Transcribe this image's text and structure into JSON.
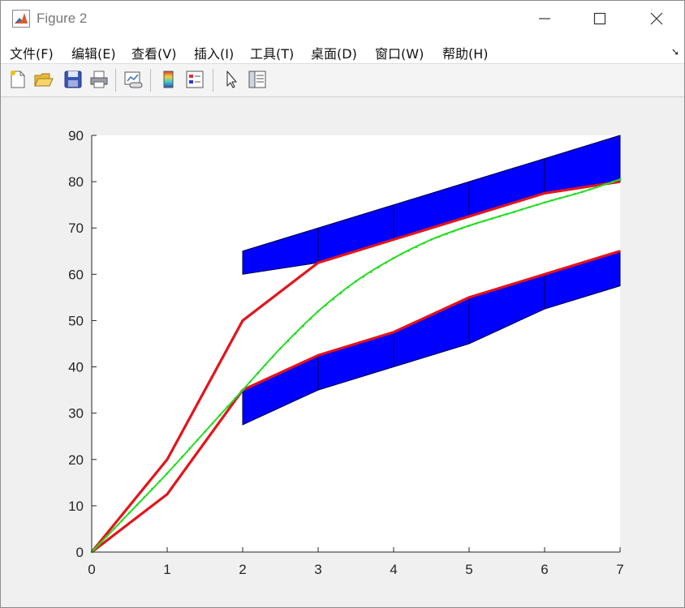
{
  "window": {
    "title": "Figure 2",
    "icon": "matlab-icon",
    "controls": [
      "minimize-icon",
      "maximize-icon",
      "close-icon"
    ]
  },
  "menu": {
    "items": [
      {
        "id": "file",
        "label": "文件(F)"
      },
      {
        "id": "edit",
        "label": "编辑(E)"
      },
      {
        "id": "view",
        "label": "查看(V)"
      },
      {
        "id": "insert",
        "label": "插入(I)"
      },
      {
        "id": "tools",
        "label": "工具(T)"
      },
      {
        "id": "desktop",
        "label": "桌面(D)"
      },
      {
        "id": "window",
        "label": "窗口(W)"
      },
      {
        "id": "help",
        "label": "帮助(H)"
      }
    ],
    "dock_icon": "dock-arrow-icon"
  },
  "toolbar": {
    "buttons": [
      "new-figure-icon",
      "open-file-icon",
      "save-icon",
      "print-icon",
      "link-plot-icon",
      "colorbar-icon",
      "legend-icon",
      "edit-plot-icon",
      "property-inspector-icon"
    ]
  },
  "colors": {
    "band": "#0000ff",
    "red_line": "#e3141b",
    "green_curve": "#22dd22",
    "axis": "#262626"
  },
  "chart_data": {
    "type": "line",
    "xlim": [
      0,
      7
    ],
    "ylim": [
      0,
      90
    ],
    "xticks": [
      "0",
      "1",
      "2",
      "3",
      "4",
      "5",
      "6",
      "7"
    ],
    "yticks": [
      "0",
      "10",
      "20",
      "30",
      "40",
      "50",
      "60",
      "70",
      "80",
      "90"
    ],
    "grid": false,
    "series": [
      {
        "kind": "line",
        "color": "#e3141b",
        "x": [
          0,
          1,
          2,
          3,
          4,
          5,
          6,
          7
        ],
        "y": [
          0,
          20,
          50,
          62.5,
          67.5,
          72.5,
          77.5,
          80
        ]
      },
      {
        "kind": "line",
        "color": "#e3141b",
        "x": [
          0,
          1,
          2,
          3,
          4,
          5,
          6,
          7
        ],
        "y": [
          0,
          12.5,
          35,
          42.5,
          47.5,
          55,
          60,
          65
        ]
      },
      {
        "kind": "curve",
        "color": "#22dd22",
        "x": [
          0,
          0.5,
          1,
          1.5,
          2,
          2.5,
          3,
          3.5,
          4,
          4.5,
          5,
          5.5,
          6,
          6.5,
          7
        ],
        "y": [
          0,
          8.5,
          17,
          26,
          35,
          44,
          52,
          58.5,
          63.5,
          67.5,
          70.5,
          73,
          75.5,
          77.8,
          80.5
        ]
      }
    ],
    "bands": [
      {
        "color": "#0000ff",
        "x": [
          2,
          3,
          4,
          5,
          6,
          7
        ],
        "upper": [
          65,
          70,
          75,
          80,
          85,
          90
        ],
        "lower": [
          60,
          62.5,
          67.5,
          72.5,
          77.5,
          80
        ]
      },
      {
        "color": "#0000ff",
        "x": [
          2,
          3,
          4,
          5,
          6,
          7
        ],
        "upper": [
          35,
          42.5,
          47.5,
          55,
          60,
          65
        ],
        "lower": [
          27.5,
          35,
          40,
          45,
          52.5,
          57.5
        ]
      }
    ]
  }
}
